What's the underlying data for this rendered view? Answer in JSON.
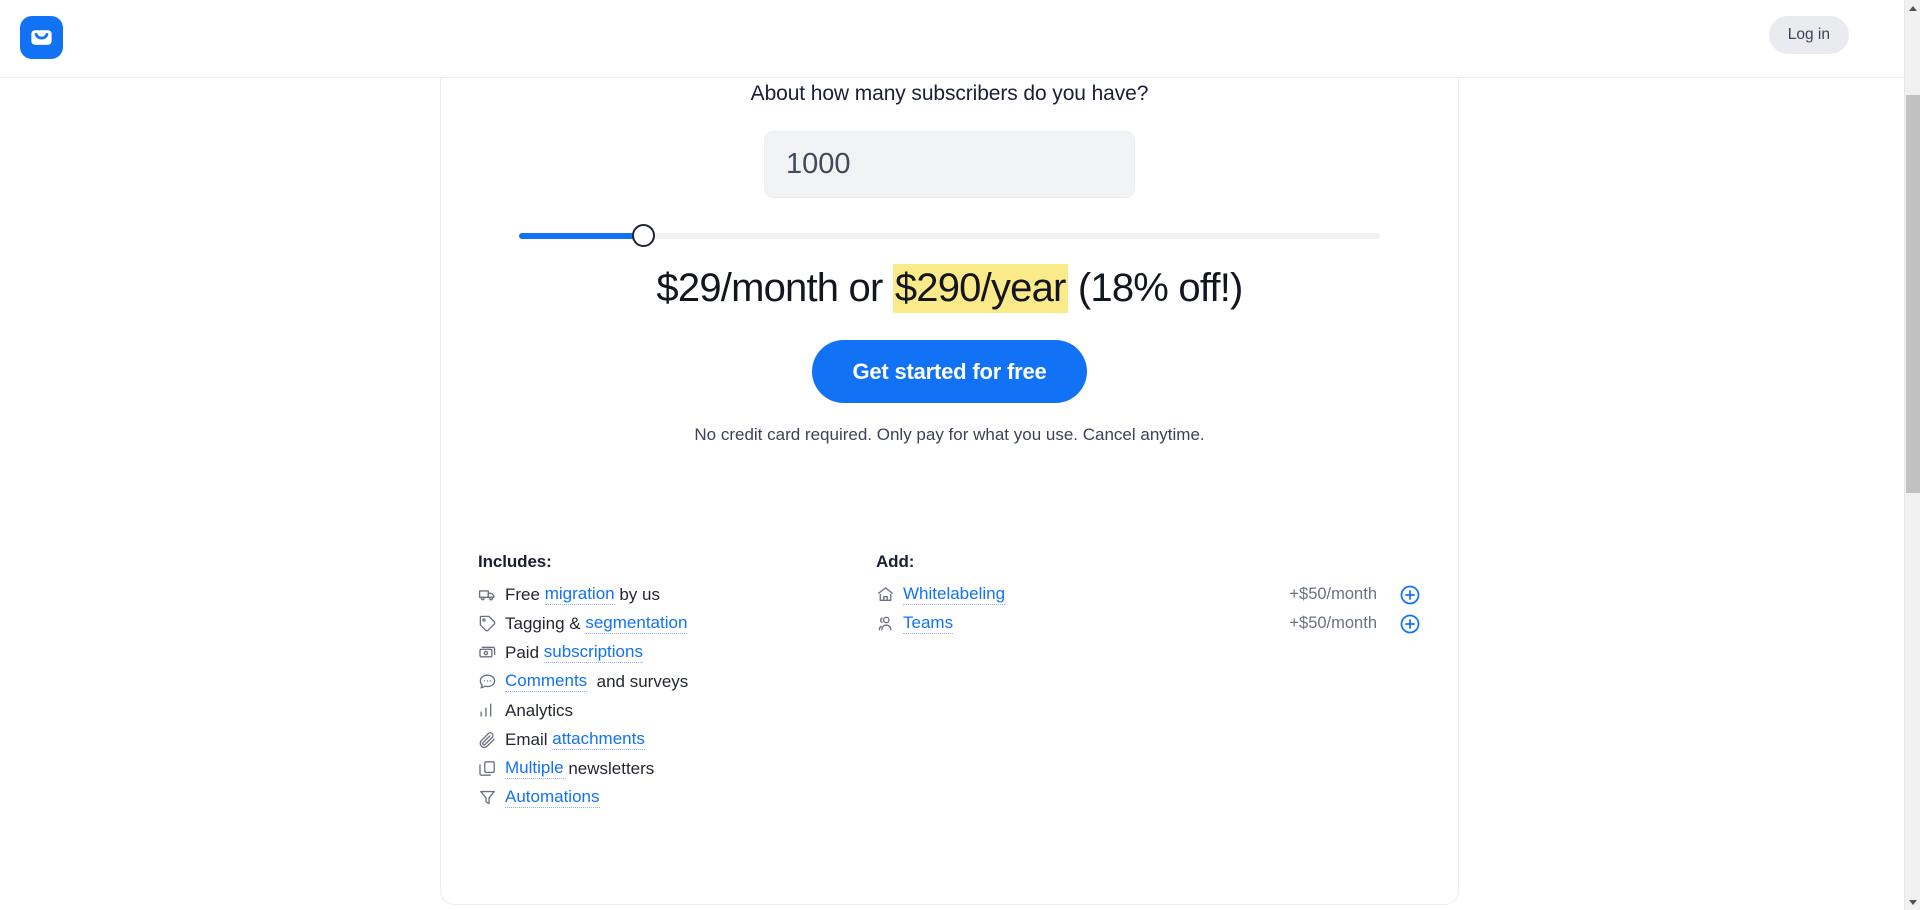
{
  "header": {
    "logo_icon": "envelope-logo-icon",
    "login_label": "Log in"
  },
  "calculator": {
    "heading": "About how many subscribers do you have?",
    "subscribers_value": "1000",
    "subscribers_placeholder": "1000",
    "slider": {
      "value": 1000,
      "fill_percent": 14.5
    },
    "price_monthly": "$29/month or ",
    "price_yearly_highlight": "$290/year",
    "price_discount": " (18% off!)",
    "cta_label": "Get started for free",
    "fineprint": "No credit card required. Only pay for what you use. Cancel anytime."
  },
  "includes": {
    "title": "Includes:",
    "items": [
      {
        "icon": "truck-icon",
        "pre": "Free ",
        "link": "migration",
        "post": " by us"
      },
      {
        "icon": "tag-icon",
        "pre": "Tagging & ",
        "link": "segmentation",
        "post": ""
      },
      {
        "icon": "money-icon",
        "pre": "Paid ",
        "link": "subscriptions",
        "post": ""
      },
      {
        "icon": "comment-icon",
        "pre": "",
        "link": "Comments",
        "post": "  and surveys"
      },
      {
        "icon": "bar-chart-icon",
        "pre": "Analytics",
        "link": "",
        "post": ""
      },
      {
        "icon": "paperclip-icon",
        "pre": "Email ",
        "link": "attachments",
        "post": ""
      },
      {
        "icon": "copy-icon",
        "pre": "",
        "link": "Multiple",
        "post": " newsletters"
      },
      {
        "icon": "funnel-icon",
        "pre": "",
        "link": "Automations",
        "post": ""
      }
    ]
  },
  "addons": {
    "title": "Add:",
    "items": [
      {
        "icon": "home-icon",
        "link": "Whitelabeling",
        "price": "+$50/month",
        "action_icon": "plus-circle-icon"
      },
      {
        "icon": "people-icon",
        "link": "Teams",
        "price": "+$50/month",
        "action_icon": "plus-circle-icon"
      }
    ]
  },
  "colors": {
    "brand_blue": "#1272f5",
    "highlight_yellow": "#fbea8a",
    "input_bg": "#f1f3f5",
    "login_bg": "#e9ebef",
    "text_dark": "#1a1f36",
    "icon_gray": "#6b7280"
  }
}
